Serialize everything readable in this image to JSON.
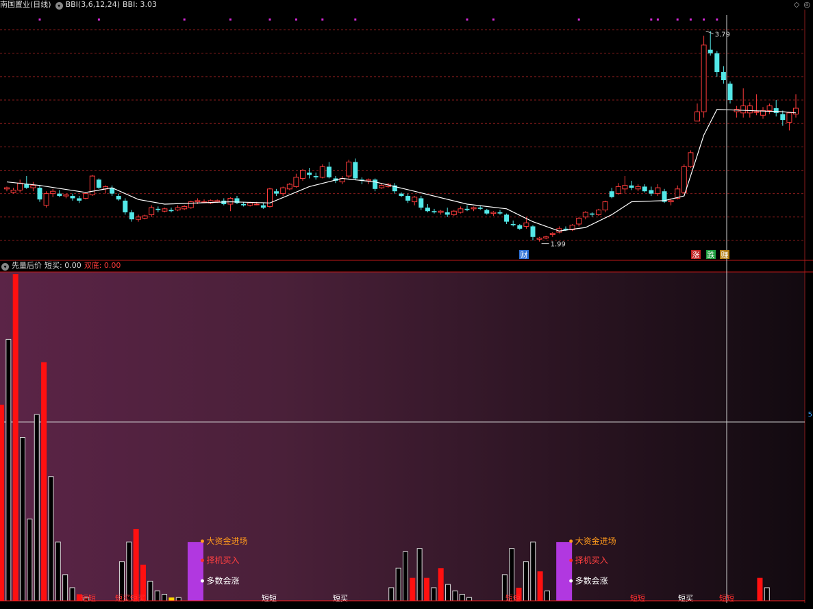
{
  "header": {
    "stock_name": "南国置业(日线)",
    "indicator_name": "BBI(3,6,12,24)",
    "indicator_value": "BBI: 3.03",
    "window_buttons": [
      "◇",
      "◎"
    ]
  },
  "sub_header": {
    "indicator_name": "先量后价",
    "short_buy": "短买: 0.00",
    "double_bottom": "双底: 0.00"
  },
  "price_labels": {
    "high": "3.79",
    "low": "1.99"
  },
  "bottom_markers": {
    "cai": "财",
    "zhang": "涨",
    "die": "跌",
    "zhuan": "赚"
  },
  "panel_text": {
    "big_fund": "大资金进场",
    "choose_buy": "择机买入",
    "majority_rise": "多数会涨",
    "short_buy_labels": [
      "短短",
      "短买短买",
      "短短",
      "短买",
      "短短",
      "短短",
      "短买",
      "短短"
    ],
    "right_tick": "5"
  },
  "colors": {
    "up": "#ff3b3b",
    "down": "#53e8e8",
    "bbi_line": "#ffffff",
    "grid": "#8a1c1c",
    "magenta": "#d62ad8",
    "purple_bar": "#b138e0",
    "orange": "#ff9a1c"
  },
  "chart_data": [
    {
      "type": "candlestick",
      "title": "南国置业(日线)",
      "ylim": [
        1.9,
        3.95
      ],
      "candles": [
        [
          2.44,
          2.46,
          2.42,
          2.45
        ],
        [
          2.41,
          2.45,
          2.4,
          2.43
        ],
        [
          2.43,
          2.52,
          2.41,
          2.49
        ],
        [
          2.48,
          2.55,
          2.44,
          2.45
        ],
        [
          2.45,
          2.5,
          2.42,
          2.47
        ],
        [
          2.45,
          2.47,
          2.33,
          2.35
        ],
        [
          2.3,
          2.42,
          2.28,
          2.4
        ],
        [
          2.4,
          2.44,
          2.37,
          2.42
        ],
        [
          2.4,
          2.43,
          2.37,
          2.38
        ],
        [
          2.38,
          2.4,
          2.36,
          2.39
        ],
        [
          2.38,
          2.4,
          2.34,
          2.36
        ],
        [
          2.36,
          2.38,
          2.32,
          2.34
        ],
        [
          2.36,
          2.41,
          2.35,
          2.4
        ],
        [
          2.39,
          2.56,
          2.38,
          2.55
        ],
        [
          2.52,
          2.53,
          2.44,
          2.45
        ],
        [
          2.44,
          2.47,
          2.4,
          2.46
        ],
        [
          2.45,
          2.47,
          2.38,
          2.4
        ],
        [
          2.38,
          2.4,
          2.34,
          2.35
        ],
        [
          2.34,
          2.36,
          2.22,
          2.24
        ],
        [
          2.24,
          2.26,
          2.16,
          2.18
        ],
        [
          2.18,
          2.22,
          2.16,
          2.2
        ],
        [
          2.19,
          2.22,
          2.18,
          2.21
        ],
        [
          2.22,
          2.3,
          2.2,
          2.28
        ],
        [
          2.27,
          2.29,
          2.24,
          2.26
        ],
        [
          2.25,
          2.28,
          2.24,
          2.27
        ],
        [
          2.26,
          2.28,
          2.24,
          2.25
        ],
        [
          2.26,
          2.3,
          2.25,
          2.28
        ],
        [
          2.27,
          2.3,
          2.26,
          2.29
        ],
        [
          2.28,
          2.34,
          2.27,
          2.33
        ],
        [
          2.33,
          2.36,
          2.31,
          2.34
        ],
        [
          2.33,
          2.35,
          2.32,
          2.33
        ],
        [
          2.32,
          2.35,
          2.31,
          2.34
        ],
        [
          2.33,
          2.35,
          2.32,
          2.34
        ],
        [
          2.34,
          2.36,
          2.3,
          2.31
        ],
        [
          2.31,
          2.37,
          2.25,
          2.36
        ],
        [
          2.36,
          2.38,
          2.31,
          2.32
        ],
        [
          2.31,
          2.33,
          2.29,
          2.3
        ],
        [
          2.3,
          2.33,
          2.29,
          2.32
        ],
        [
          2.31,
          2.33,
          2.3,
          2.31
        ],
        [
          2.3,
          2.32,
          2.27,
          2.28
        ],
        [
          2.29,
          2.45,
          2.28,
          2.44
        ],
        [
          2.42,
          2.44,
          2.38,
          2.4
        ],
        [
          2.4,
          2.46,
          2.38,
          2.45
        ],
        [
          2.44,
          2.49,
          2.43,
          2.48
        ],
        [
          2.46,
          2.57,
          2.45,
          2.54
        ],
        [
          2.53,
          2.61,
          2.51,
          2.6
        ],
        [
          2.58,
          2.62,
          2.53,
          2.56
        ],
        [
          2.55,
          2.58,
          2.52,
          2.54
        ],
        [
          2.54,
          2.65,
          2.53,
          2.63
        ],
        [
          2.63,
          2.67,
          2.53,
          2.54
        ],
        [
          2.53,
          2.55,
          2.49,
          2.51
        ],
        [
          2.5,
          2.55,
          2.48,
          2.53
        ],
        [
          2.55,
          2.69,
          2.53,
          2.67
        ],
        [
          2.67,
          2.7,
          2.52,
          2.53
        ],
        [
          2.52,
          2.54,
          2.48,
          2.51
        ],
        [
          2.51,
          2.53,
          2.48,
          2.52
        ],
        [
          2.52,
          2.53,
          2.42,
          2.44
        ],
        [
          2.45,
          2.49,
          2.44,
          2.47
        ],
        [
          2.46,
          2.49,
          2.45,
          2.48
        ],
        [
          2.47,
          2.49,
          2.4,
          2.42
        ],
        [
          2.4,
          2.41,
          2.37,
          2.38
        ],
        [
          2.38,
          2.4,
          2.32,
          2.34
        ],
        [
          2.33,
          2.38,
          2.3,
          2.37
        ],
        [
          2.36,
          2.38,
          2.26,
          2.28
        ],
        [
          2.28,
          2.31,
          2.24,
          2.25
        ],
        [
          2.25,
          2.27,
          2.23,
          2.24
        ],
        [
          2.24,
          2.26,
          2.22,
          2.25
        ],
        [
          2.24,
          2.28,
          2.2,
          2.22
        ],
        [
          2.22,
          2.26,
          2.21,
          2.25
        ],
        [
          2.24,
          2.29,
          2.23,
          2.27
        ],
        [
          2.27,
          2.3,
          2.25,
          2.26
        ],
        [
          2.27,
          2.29,
          2.25,
          2.28
        ],
        [
          2.28,
          2.3,
          2.26,
          2.27
        ],
        [
          2.26,
          2.27,
          2.22,
          2.23
        ],
        [
          2.23,
          2.25,
          2.21,
          2.24
        ],
        [
          2.24,
          2.26,
          2.22,
          2.23
        ],
        [
          2.22,
          2.23,
          2.14,
          2.16
        ],
        [
          2.14,
          2.17,
          2.12,
          2.13
        ],
        [
          2.13,
          2.14,
          2.09,
          2.1
        ],
        [
          2.12,
          2.2,
          2.1,
          2.15
        ],
        [
          2.12,
          2.13,
          2.0,
          2.03
        ],
        [
          2.01,
          2.03,
          1.99,
          2.02
        ],
        [
          2.02,
          2.04,
          2.01,
          2.03
        ],
        [
          2.05,
          2.07,
          2.03,
          2.06
        ],
        [
          2.07,
          2.12,
          2.06,
          2.1
        ],
        [
          2.1,
          2.12,
          2.08,
          2.09
        ],
        [
          2.09,
          2.14,
          2.08,
          2.13
        ],
        [
          2.14,
          2.2,
          2.12,
          2.19
        ],
        [
          2.2,
          2.25,
          2.18,
          2.24
        ],
        [
          2.23,
          2.24,
          2.2,
          2.22
        ],
        [
          2.22,
          2.27,
          2.21,
          2.26
        ],
        [
          2.26,
          2.34,
          2.24,
          2.33
        ],
        [
          2.42,
          2.45,
          2.36,
          2.37
        ],
        [
          2.4,
          2.49,
          2.39,
          2.46
        ],
        [
          2.44,
          2.55,
          2.4,
          2.47
        ],
        [
          2.47,
          2.51,
          2.43,
          2.45
        ],
        [
          2.44,
          2.48,
          2.42,
          2.46
        ],
        [
          2.46,
          2.48,
          2.41,
          2.42
        ],
        [
          2.43,
          2.46,
          2.38,
          2.4
        ],
        [
          2.4,
          2.48,
          2.38,
          2.45
        ],
        [
          2.42,
          2.44,
          2.32,
          2.33
        ],
        [
          2.33,
          2.36,
          2.3,
          2.34
        ],
        [
          2.36,
          2.47,
          2.35,
          2.44
        ],
        [
          2.41,
          2.65,
          2.4,
          2.63
        ],
        [
          2.63,
          2.77,
          2.62,
          2.75
        ],
        [
          3.02,
          3.17,
          3.02,
          3.1
        ],
        [
          3.1,
          3.75,
          3.05,
          3.67
        ],
        [
          3.63,
          3.79,
          3.58,
          3.6
        ],
        [
          3.6,
          3.62,
          3.4,
          3.44
        ],
        [
          3.44,
          3.49,
          3.34,
          3.37
        ],
        [
          3.34,
          3.36,
          3.17,
          3.2
        ],
        [
          3.1,
          3.15,
          3.05,
          3.12
        ],
        [
          3.09,
          3.3,
          3.05,
          3.15
        ],
        [
          3.09,
          3.18,
          3.05,
          3.15
        ],
        [
          3.1,
          3.25,
          3.07,
          3.1
        ],
        [
          3.07,
          3.14,
          3.04,
          3.11
        ],
        [
          3.11,
          3.17,
          3.08,
          3.15
        ],
        [
          3.13,
          3.2,
          3.06,
          3.09
        ],
        [
          3.08,
          3.11,
          2.98,
          3.03
        ],
        [
          3.01,
          3.07,
          2.94,
          3.09
        ],
        [
          3.08,
          3.25,
          3.05,
          3.13
        ]
      ],
      "bbi": [
        [
          0,
          2.5
        ],
        [
          5,
          2.47
        ],
        [
          12,
          2.41
        ],
        [
          16,
          2.45
        ],
        [
          20,
          2.35
        ],
        [
          24,
          2.31
        ],
        [
          34,
          2.33
        ],
        [
          40,
          2.32
        ],
        [
          46,
          2.46
        ],
        [
          51,
          2.53
        ],
        [
          56,
          2.5
        ],
        [
          62,
          2.42
        ],
        [
          70,
          2.31
        ],
        [
          76,
          2.27
        ],
        [
          80,
          2.16
        ],
        [
          84,
          2.08
        ],
        [
          88,
          2.11
        ],
        [
          92,
          2.22
        ],
        [
          95,
          2.33
        ],
        [
          100,
          2.34
        ],
        [
          103,
          2.38
        ],
        [
          106,
          2.9
        ],
        [
          108,
          3.12
        ],
        [
          113,
          3.11
        ],
        [
          118,
          3.1
        ],
        [
          120,
          3.09
        ]
      ],
      "top_markers": [
        5,
        14,
        27,
        34,
        40,
        44,
        48,
        53,
        70,
        74,
        87,
        98,
        99,
        102,
        104,
        106,
        108
      ]
    },
    {
      "type": "bar",
      "title": "先量后价",
      "ylim": [
        0,
        100
      ],
      "bars": [
        [
          1,
          60,
          "red"
        ],
        [
          2,
          80,
          "black"
        ],
        [
          3,
          100,
          "red"
        ],
        [
          4,
          50,
          "black"
        ],
        [
          5,
          25,
          "black"
        ],
        [
          6,
          57,
          "black"
        ],
        [
          7,
          73,
          "red"
        ],
        [
          8,
          38,
          "black"
        ],
        [
          9,
          18,
          "black"
        ],
        [
          10,
          8,
          "black"
        ],
        [
          11,
          4,
          "black"
        ],
        [
          12,
          2,
          "red"
        ],
        [
          13,
          1,
          "black"
        ],
        [
          18,
          12,
          "black"
        ],
        [
          19,
          18,
          "black"
        ],
        [
          20,
          22,
          "red"
        ],
        [
          21,
          11,
          "red"
        ],
        [
          22,
          6,
          "black"
        ],
        [
          23,
          3,
          "black"
        ],
        [
          24,
          2,
          "black"
        ],
        [
          25,
          1,
          "yellow"
        ],
        [
          26,
          1,
          "black"
        ],
        [
          28,
          18,
          "purple"
        ],
        [
          56,
          4,
          "black"
        ],
        [
          57,
          10,
          "black"
        ],
        [
          58,
          15,
          "black"
        ],
        [
          59,
          7,
          "red"
        ],
        [
          60,
          16,
          "black"
        ],
        [
          61,
          7,
          "red"
        ],
        [
          62,
          4,
          "black"
        ],
        [
          63,
          10,
          "red"
        ],
        [
          64,
          5,
          "black"
        ],
        [
          65,
          3,
          "black"
        ],
        [
          66,
          2,
          "black"
        ],
        [
          67,
          1,
          "black"
        ],
        [
          72,
          8,
          "black"
        ],
        [
          73,
          16,
          "black"
        ],
        [
          74,
          4,
          "red"
        ],
        [
          75,
          12,
          "black"
        ],
        [
          76,
          18,
          "black"
        ],
        [
          77,
          9,
          "red"
        ],
        [
          78,
          3,
          "black"
        ],
        [
          80,
          18,
          "purple"
        ],
        [
          108,
          7,
          "red"
        ],
        [
          109,
          4,
          "black"
        ]
      ],
      "signals": [
        "大资金进场",
        "择机买入",
        "多数会涨"
      ]
    }
  ]
}
